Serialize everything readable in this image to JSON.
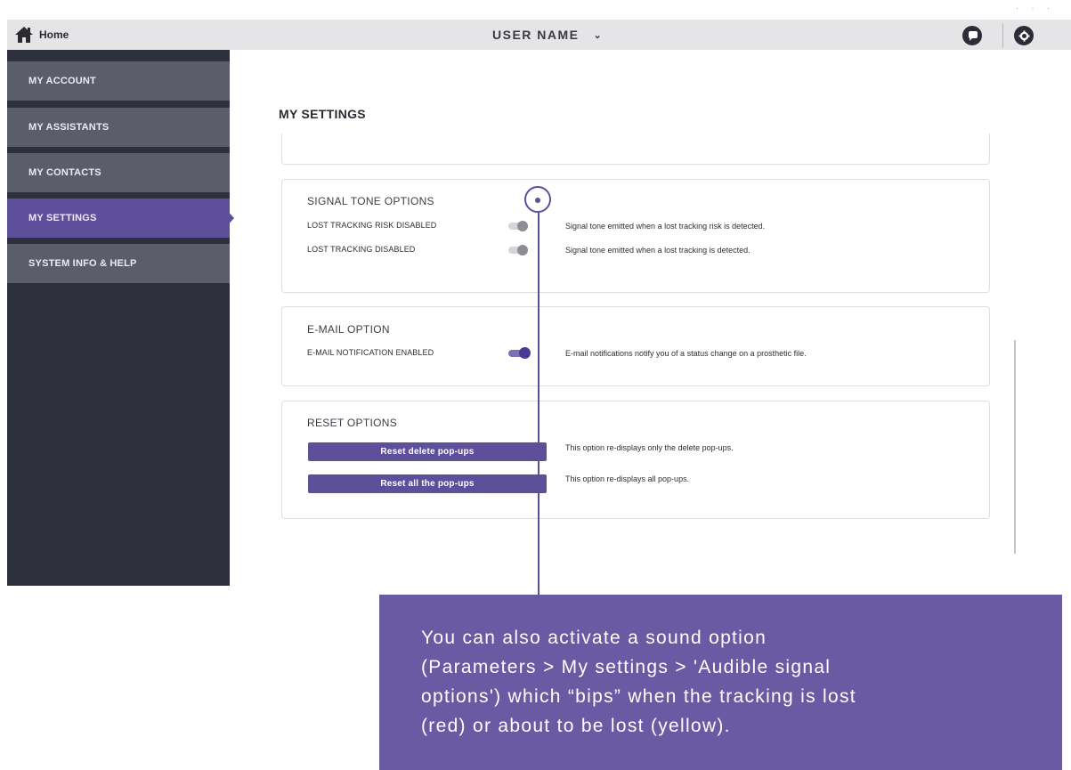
{
  "window": {
    "controls": "· · ·"
  },
  "topbar": {
    "home_icon": "home-icon",
    "home_label": "Home",
    "user_name": "USER NAME",
    "user_chevron": "⌄",
    "chat_icon": "chat-bubble-icon",
    "settings_icon": "gear-icon"
  },
  "sidebar": {
    "items": [
      {
        "label": "MY ACCOUNT",
        "active": false
      },
      {
        "label": "MY ASSISTANTS",
        "active": false
      },
      {
        "label": "MY CONTACTS",
        "active": false
      },
      {
        "label": "MY SETTINGS",
        "active": true
      },
      {
        "label": "SYSTEM INFO & HELP",
        "active": false
      }
    ]
  },
  "main": {
    "title": "MY SETTINGS",
    "signal_tone": {
      "title": "SIGNAL TONE OPTIONS",
      "rows": [
        {
          "label": "LOST TRACKING RISK DISABLED",
          "enabled": false,
          "description": "Signal tone emitted when a lost tracking risk is detected."
        },
        {
          "label": "LOST TRACKING DISABLED",
          "enabled": false,
          "description": "Signal tone emitted when a lost tracking is detected."
        }
      ]
    },
    "email": {
      "title": "E-MAIL OPTION",
      "rows": [
        {
          "label": "E-MAIL NOTIFICATION ENABLED",
          "enabled": true,
          "description": "E-mail notifications notify you of a status change on a prosthetic file."
        }
      ]
    },
    "reset": {
      "title": "RESET OPTIONS",
      "buttons": [
        {
          "label": "Reset delete pop-ups",
          "description": "This option re-displays only the delete pop-ups."
        },
        {
          "label": "Reset all the pop-ups",
          "description": "This option re-displays all pop-ups."
        }
      ]
    }
  },
  "callout": {
    "text": "You can also activate a sound option\n(Parameters > My settings > 'Audible signal\noptions') which “bips” when the tracking is lost\n(red) or about to be lost (yellow).",
    "color": "#6a5aa4"
  },
  "colors": {
    "accent": "#5e4f9b",
    "sidebar_bg": "#2f303d",
    "sidebar_item": "#5c5d6b",
    "topbar_bg": "#e5e5e7"
  }
}
